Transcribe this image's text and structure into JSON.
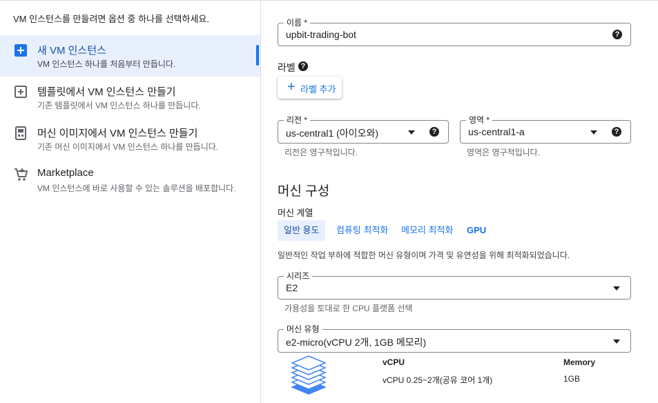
{
  "left_pane": {
    "intro": "VM 인스턴스를 만들려면 옵션 중 하나를 선택하세요.",
    "options": [
      {
        "title": "새 VM 인스턴스",
        "desc": "VM 인스턴스 하나를 처음부터 만듭니다.",
        "icon": "add-box-icon"
      },
      {
        "title": "템플릿에서 VM 인스턴스 만들기",
        "desc": "기존 템플릿에서 VM 인스턴스 하나를 만듭니다.",
        "icon": "template-icon"
      },
      {
        "title": "머신 이미지에서 VM 인스턴스 만들기",
        "desc": "기존 머신 이미지에서 VM 인스턴스 하나를 만듭니다.",
        "icon": "machine-image-icon"
      },
      {
        "title": "Marketplace",
        "desc": "VM 인스턴스에 바로 사용할 수 있는 솔루션을 배포합니다.",
        "icon": "cart-icon"
      }
    ]
  },
  "form": {
    "name": {
      "label": "이름 *",
      "value": "upbit-trading-bot"
    },
    "labels": {
      "title": "라벨",
      "add_button": "라벨 추가"
    },
    "region": {
      "label": "리전 *",
      "value": "us-central1 (아이오와)",
      "hint": "리전은 영구적입니다."
    },
    "zone": {
      "label": "영역 *",
      "value": "us-central1-a",
      "hint": "영역은 영구적입니다."
    },
    "machine_config": {
      "heading": "머신 구성",
      "family_label": "머신 계열",
      "tabs": [
        "일반 용도",
        "컴퓨팅 최적화",
        "메모리 최적화",
        "GPU"
      ],
      "family_desc": "일반적인 작업 부하에 적합한 머신 유형이며 가격 및 유연성을 위해 최적화되었습니다.",
      "series": {
        "label": "시리즈",
        "value": "E2",
        "hint": "가용성을 토대로 한 CPU 플랫폼 선택"
      },
      "machine_type": {
        "label": "머신 유형",
        "value": "e2-micro(vCPU 2개, 1GB 메모리)"
      },
      "summary": {
        "vcpu_header": "vCPU",
        "vcpu_value": "vCPU 0.25~2개(공유 코어 1개)",
        "memory_header": "Memory",
        "memory_value": "1GB"
      }
    }
  },
  "colors": {
    "accent": "#1a73e8",
    "selected_bg": "#e8f0fe",
    "border": "#80868b",
    "stack_icon": "#4285f4"
  }
}
